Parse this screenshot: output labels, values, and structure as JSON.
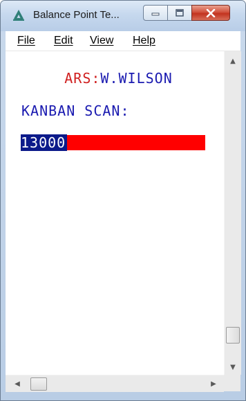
{
  "window": {
    "title": "Balance Point Te...",
    "icon": "balance-point-app-icon",
    "controls": {
      "minimize_icon": "minimize-icon",
      "maximize_icon": "maximize-icon",
      "close_icon": "close-icon"
    }
  },
  "menu": {
    "items": [
      {
        "label": "File"
      },
      {
        "label": "Edit"
      },
      {
        "label": "View"
      },
      {
        "label": "Help"
      }
    ]
  },
  "terminal": {
    "user_prefix": "ARS:",
    "user_name": "W.WILSON",
    "scan_label": "KANBAN SCAN:",
    "scan_value": "13000"
  },
  "colors": {
    "prefix_text": "#d02020",
    "terminal_text": "#1a1ab0",
    "input_field": "#ff0000",
    "selection_bg": "#0c1a8a"
  }
}
